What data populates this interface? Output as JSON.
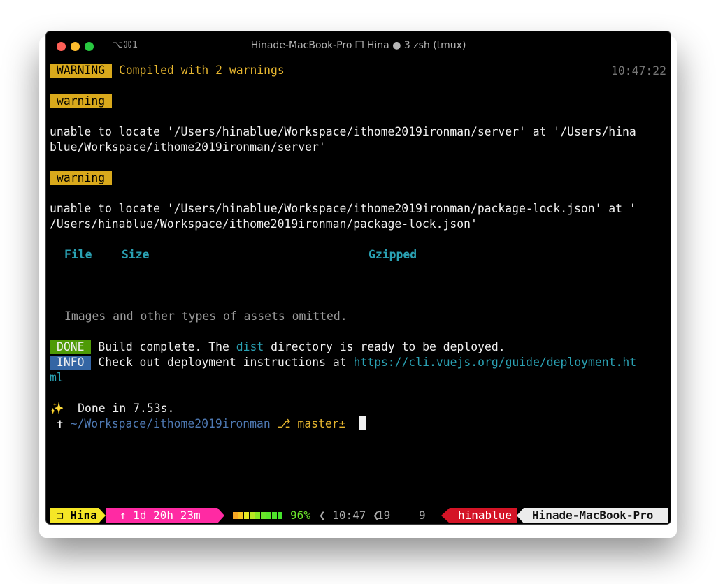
{
  "window": {
    "shortcut": "⌥⌘1",
    "title": "Hinade-MacBook-Pro ❐ Hina ● 3 zsh (tmux)"
  },
  "terminal": {
    "time": "10:47:22",
    "warning_badge": "WARNING",
    "compiled": " Compiled with 2 warnings",
    "warning_label": "warning",
    "msg1_line1": "unable to locate '/Users/hinablue/Workspace/ithome2019ironman/server' at '/Users/hina",
    "msg1_line2": "blue/Workspace/ithome2019ironman/server'",
    "msg2_line1": "unable to locate '/Users/hinablue/Workspace/ithome2019ironman/package-lock.json' at '",
    "msg2_line2": "/Users/hinablue/Workspace/ithome2019ironman/package-lock.json'",
    "table_headers": [
      "File",
      "Size",
      "Gzipped"
    ],
    "assets_note": "Images and other types of assets omitted.",
    "done_badge": "DONE",
    "done_text_a": " Build complete. The ",
    "done_dist": "dist",
    "done_text_b": " directory is ready to be deployed.",
    "info_badge": "INFO",
    "info_text": " Check out deployment instructions at ",
    "info_link_a": "https://cli.vuejs.org/guide/deployment.ht",
    "info_link_b": "ml",
    "sparkles": "✨",
    "done_time": "  Done in 7.53s.",
    "prompt_symbol": " ✝ ",
    "prompt_path": "~/Workspace/ithome2019ironman",
    "prompt_branch_icon": " ⎇ ",
    "prompt_branch": "master±"
  },
  "status_bar": {
    "session": "❐ Hina",
    "uptime": "↑ 1d 20h 23m",
    "battery_percent": "96%",
    "battery_level": 0.96,
    "battery_colors": [
      "#f6a623",
      "#f6c323",
      "#e6e823",
      "#b9e823",
      "#8ae823",
      "#6be42b",
      "#5be42b",
      "#4fe42b",
      "#45e42b"
    ],
    "clock": "❮ 10:47 ❮",
    "day": "19",
    "num": "9",
    "user": "hinablue",
    "host": "Hinade-MacBook-Pro",
    "colors": {
      "session": "#f5e626",
      "uptime": "#ff2aa3",
      "user": "#d41426",
      "host": "#ececec"
    }
  }
}
